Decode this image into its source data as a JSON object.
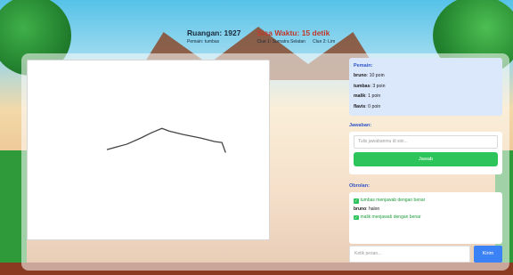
{
  "header": {
    "room_label": "Ruangan: 1927",
    "players_label": "Pemain: tumbas",
    "timer_label": "Sisa Waktu: 15 detik",
    "clue1": "Clue 1: Sumatra Selatan",
    "clue2": "Clue 2: Lim"
  },
  "players": {
    "title": "Pemain:",
    "items": [
      {
        "name": "bruno",
        "score": ": 10 poin"
      },
      {
        "name": "tumbas",
        "score": ": 3 poin"
      },
      {
        "name": "malik",
        "score": ": 1 poin"
      },
      {
        "name": "flavis",
        "score": ": 0 poin"
      }
    ]
  },
  "answer": {
    "title": "Jawaban:",
    "placeholder": "Tulis jawabanmu di sini...",
    "button": "Jawab"
  },
  "chat": {
    "title": "Obrolan:",
    "messages": [
      {
        "type": "system",
        "text": "tumbas menjawab dengan benar"
      },
      {
        "type": "user",
        "user": "bruno",
        "text": ": halon"
      },
      {
        "type": "system",
        "text": "malik menjawab dengan benar"
      }
    ],
    "placeholder": "Ketik pesan...",
    "send": "Kirim"
  },
  "colors": {
    "accent": "#2f55c8",
    "success": "#2ec45c",
    "send": "#3b82f6",
    "timer": "#c0392b"
  }
}
